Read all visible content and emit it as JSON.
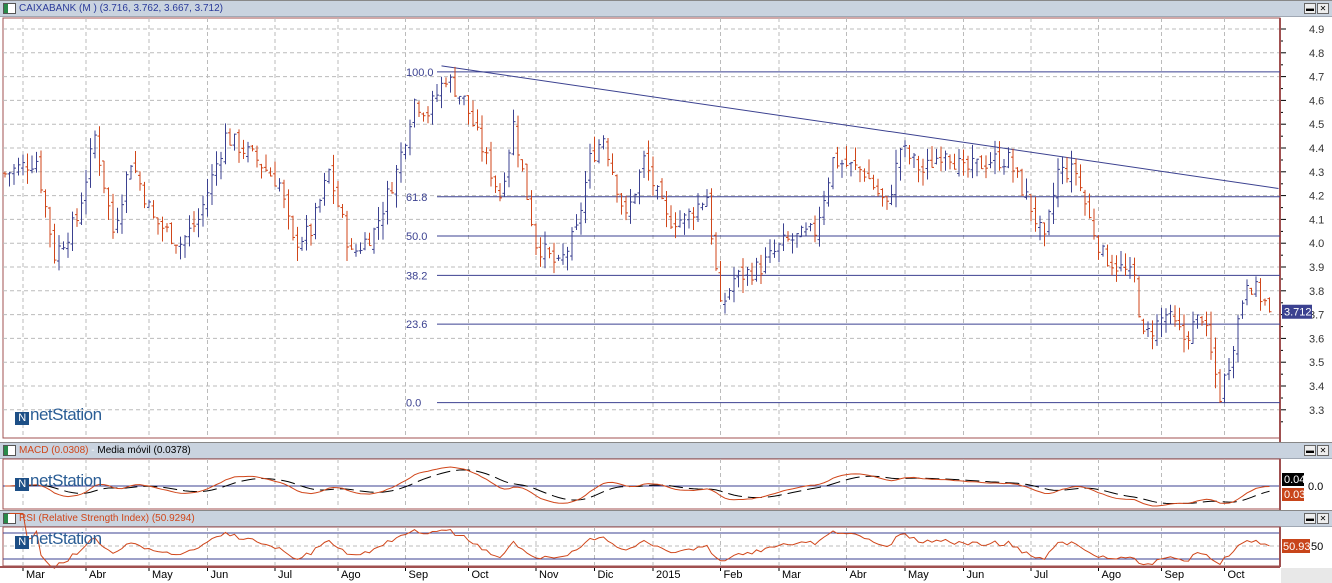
{
  "main": {
    "title": "CAIXABANK (M ) (3.716, 3.762, 3.667, 3.712)",
    "last_price": "3.712",
    "watermark": "netStation"
  },
  "macd": {
    "title_macd": "MACD (0.0308)",
    "title_sep": " - ",
    "title_ma": "Media móvil (0.0378)",
    "tag_black": "0.04",
    "tag_orange": "0.03",
    "zero_label": "0.0"
  },
  "rsi": {
    "title": "RSI (Relative Strength Index) (50.9294)",
    "tag": "50.93",
    "mid_label": "50"
  },
  "buttons": {
    "minimize": "▬",
    "close": "✕"
  },
  "colors": {
    "up": "#3b4190",
    "down": "#d0461a",
    "trend": "#3b4190",
    "macd": "#d0461a",
    "signal": "#000000"
  },
  "chart_data": {
    "type": "ohlc",
    "x_unit": "trading day index",
    "ylim": [
      3.2,
      4.95
    ],
    "yticks": [
      "4.9",
      "4.8",
      "4.7",
      "4.6",
      "4.5",
      "4.4",
      "4.3",
      "4.2",
      "4.1",
      "4.0",
      "3.9",
      "3.8",
      "3.7",
      "3.6",
      "3.5",
      "3.4",
      "3.3"
    ],
    "months": [
      {
        "label": "Mar",
        "day": 4
      },
      {
        "label": "Abr",
        "day": 18
      },
      {
        "label": "May",
        "day": 32
      },
      {
        "label": "Jun",
        "day": 45
      },
      {
        "label": "Jul",
        "day": 60
      },
      {
        "label": "Ago",
        "day": 74
      },
      {
        "label": "Sep",
        "day": 89
      },
      {
        "label": "Oct",
        "day": 103
      },
      {
        "label": "Nov",
        "day": 118
      },
      {
        "label": "Dic",
        "day": 131
      },
      {
        "label": "2015",
        "day": 144
      },
      {
        "label": "Feb",
        "day": 159
      },
      {
        "label": "Mar",
        "day": 172
      },
      {
        "label": "Abr",
        "day": 187
      },
      {
        "label": "May",
        "day": 200
      },
      {
        "label": "Jun",
        "day": 213
      },
      {
        "label": "Jul",
        "day": 228
      },
      {
        "label": "Ago",
        "day": 243
      },
      {
        "label": "Sep",
        "day": 257
      },
      {
        "label": "Oct",
        "day": 271
      }
    ],
    "price_path": [
      [
        1,
        4.3
      ],
      [
        7,
        4.35
      ],
      [
        11,
        3.95
      ],
      [
        16,
        4.1
      ],
      [
        20,
        4.45
      ],
      [
        24,
        4.05
      ],
      [
        28,
        4.35
      ],
      [
        33,
        4.1
      ],
      [
        39,
        4.0
      ],
      [
        43,
        4.1
      ],
      [
        49,
        4.45
      ],
      [
        56,
        4.35
      ],
      [
        61,
        4.25
      ],
      [
        64,
        4.0
      ],
      [
        68,
        4.05
      ],
      [
        72,
        4.3
      ],
      [
        77,
        3.95
      ],
      [
        82,
        4.05
      ],
      [
        87,
        4.3
      ],
      [
        91,
        4.6
      ],
      [
        94,
        4.55
      ],
      [
        98,
        4.7
      ],
      [
        102,
        4.6
      ],
      [
        106,
        4.4
      ],
      [
        110,
        4.2
      ],
      [
        113,
        4.5
      ],
      [
        118,
        4.0
      ],
      [
        123,
        3.9
      ],
      [
        127,
        4.05
      ],
      [
        130,
        4.35
      ],
      [
        133,
        4.45
      ],
      [
        138,
        4.1
      ],
      [
        142,
        4.35
      ],
      [
        147,
        4.1
      ],
      [
        151,
        4.1
      ],
      [
        156,
        4.2
      ],
      [
        159,
        3.72
      ],
      [
        162,
        3.85
      ],
      [
        168,
        3.9
      ],
      [
        173,
        4.0
      ],
      [
        180,
        4.05
      ],
      [
        184,
        4.35
      ],
      [
        191,
        4.3
      ],
      [
        196,
        4.15
      ],
      [
        199,
        4.4
      ],
      [
        204,
        4.3
      ],
      [
        209,
        4.4
      ],
      [
        213,
        4.3
      ],
      [
        219,
        4.35
      ],
      [
        223,
        4.35
      ],
      [
        228,
        4.15
      ],
      [
        231,
        4.0
      ],
      [
        234,
        4.3
      ],
      [
        238,
        4.3
      ],
      [
        241,
        4.1
      ],
      [
        244,
        3.95
      ],
      [
        251,
        3.85
      ],
      [
        253,
        3.6
      ],
      [
        258,
        3.7
      ],
      [
        262,
        3.6
      ],
      [
        266,
        3.7
      ],
      [
        270,
        3.36
      ],
      [
        272,
        3.5
      ],
      [
        276,
        3.85
      ],
      [
        280,
        3.75
      ],
      [
        281,
        3.712
      ]
    ],
    "last_day": 281,
    "fibonacci": [
      {
        "label": "100.0",
        "value": 4.72
      },
      {
        "label": "61.8",
        "value": 4.195
      },
      {
        "label": "50.0",
        "value": 4.03
      },
      {
        "label": "38.2",
        "value": 3.865
      },
      {
        "label": "23.6",
        "value": 3.66
      },
      {
        "label": "0.0",
        "value": 3.33
      }
    ],
    "fib_start_day": 96,
    "trendline": {
      "from": [
        97,
        4.745
      ],
      "to": [
        283,
        4.23
      ]
    },
    "rsi_levels": [
      70,
      50,
      30
    ],
    "macd_params": [
      12,
      26,
      9
    ],
    "rsi_period": 14
  }
}
